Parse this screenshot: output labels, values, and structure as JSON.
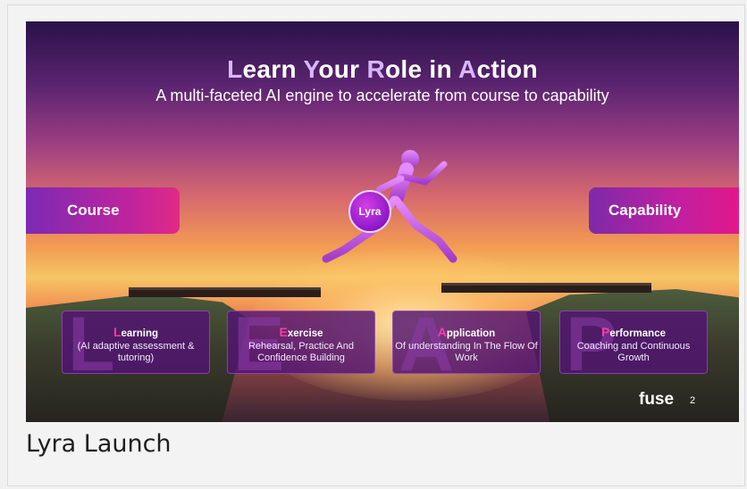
{
  "slide": {
    "title_parts": [
      {
        "text": "L",
        "accent": true
      },
      {
        "text": "earn ",
        "accent": false
      },
      {
        "text": "Y",
        "accent": true
      },
      {
        "text": "our ",
        "accent": false
      },
      {
        "text": "R",
        "accent": true
      },
      {
        "text": "ole in ",
        "accent": false
      },
      {
        "text": "A",
        "accent": true
      },
      {
        "text": "ction",
        "accent": false
      }
    ],
    "subtitle": "A multi-faceted AI engine to accelerate from course to capability",
    "left_card": "Course",
    "right_card": "Capability",
    "center_badge": "Lyra",
    "leap": [
      {
        "letter": "L",
        "rest": "earning",
        "desc": "(AI adaptive assessment & tutoring)"
      },
      {
        "letter": "E",
        "rest": "xercise",
        "desc": "Rehearsal, Practice And Confidence Building"
      },
      {
        "letter": "A",
        "rest": "pplication",
        "desc": "Of understanding In The Flow Of Work"
      },
      {
        "letter": "P",
        "rest": "erformance",
        "desc": "Coaching and Continuous Growth"
      }
    ],
    "brand": "fuse",
    "page_number": "2"
  },
  "caption": "Lyra Launch",
  "colors": {
    "title_accent": "#d8b6ff",
    "leap_accent": "#ff3aa7",
    "card_gradient_start": "#7c2ab4",
    "card_gradient_end": "#e12a86",
    "badge": "#8d18c8"
  },
  "icons": {
    "runner": "running-figure-illustration",
    "brand_logo": "fuse-logo"
  }
}
